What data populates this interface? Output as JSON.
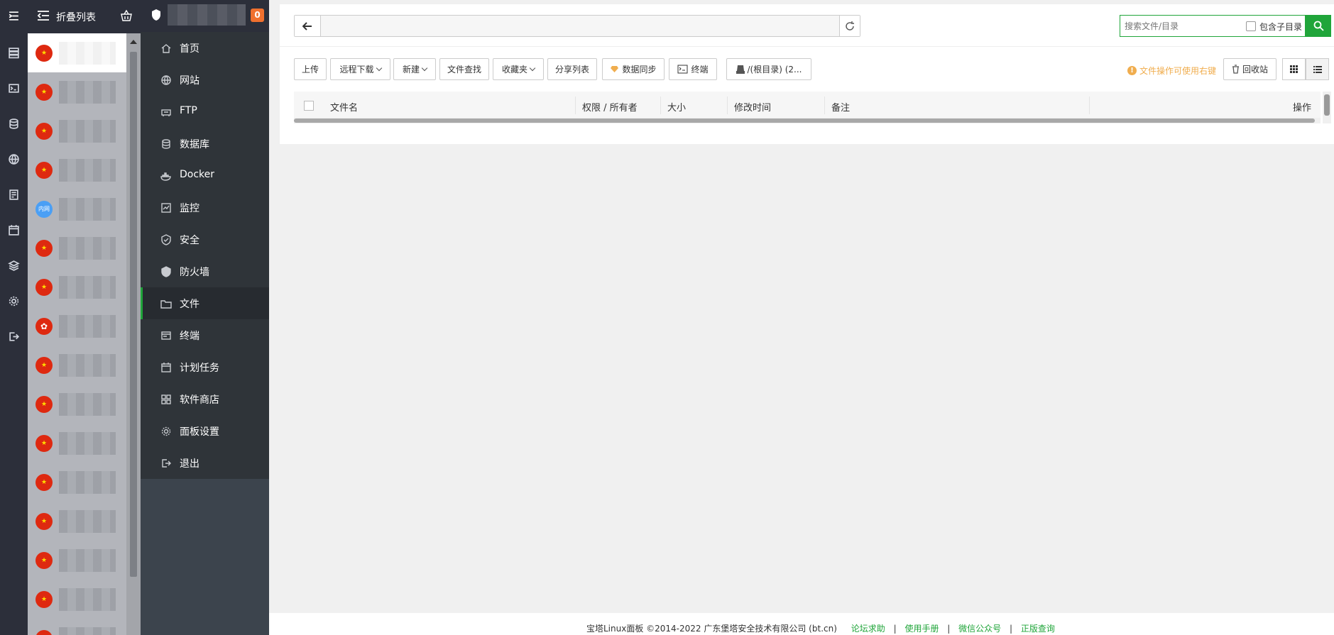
{
  "servers_panel": {
    "title": "折叠列表",
    "items": [
      {
        "flag": "cn",
        "selected": true
      },
      {
        "flag": "cn"
      },
      {
        "flag": "cn"
      },
      {
        "flag": "cn"
      },
      {
        "flag": "lan",
        "flag_text": "内网"
      },
      {
        "flag": "cn"
      },
      {
        "flag": "cn"
      },
      {
        "flag": "hk"
      },
      {
        "flag": "cn"
      },
      {
        "flag": "cn"
      },
      {
        "flag": "cn"
      },
      {
        "flag": "cn"
      },
      {
        "flag": "cn"
      },
      {
        "flag": "cn"
      },
      {
        "flag": "cn"
      },
      {
        "flag": "cn"
      }
    ]
  },
  "header": {
    "badge": "0"
  },
  "nav": {
    "items": [
      {
        "label": "首页",
        "icon": "home-icon"
      },
      {
        "label": "网站",
        "icon": "globe-icon"
      },
      {
        "label": "FTP",
        "icon": "ftp-icon"
      },
      {
        "label": "数据库",
        "icon": "database-icon"
      },
      {
        "label": "Docker",
        "icon": "docker-icon"
      },
      {
        "label": "监控",
        "icon": "monitor-icon"
      },
      {
        "label": "安全",
        "icon": "shield-icon"
      },
      {
        "label": "防火墙",
        "icon": "firewall-icon"
      },
      {
        "label": "文件",
        "icon": "folder-icon",
        "active": true
      },
      {
        "label": "终端",
        "icon": "terminal-icon"
      },
      {
        "label": "计划任务",
        "icon": "calendar-icon"
      },
      {
        "label": "软件商店",
        "icon": "apps-icon"
      },
      {
        "label": "面板设置",
        "icon": "gear-icon"
      },
      {
        "label": "退出",
        "icon": "logout-icon"
      }
    ]
  },
  "files": {
    "path_value": "",
    "search_placeholder": "搜索文件/目录",
    "include_subdir_label": "包含子目录",
    "toolbar": {
      "upload": "上传",
      "remote_download": "远程下载",
      "new": "新建",
      "file_search": "文件查找",
      "favorites": "收藏夹",
      "share_list": "分享列表",
      "data_sync": "数据同步",
      "terminal": "终端",
      "disk": "/(根目录) (2..."
    },
    "tip": "文件操作可使用右键",
    "recycle_bin": "回收站",
    "columns": {
      "name": "文件名",
      "perm_owner": "权限 / 所有者",
      "size": "大小",
      "mtime": "修改时间",
      "remark": "备注",
      "actions": "操作"
    }
  },
  "footer": {
    "copyright": "宝塔Linux面板 ©2014-2022 广东堡塔安全技术有限公司 (bt.cn)",
    "links": [
      "论坛求助",
      "使用手册",
      "微信公众号",
      "正版查询"
    ]
  },
  "colors": {
    "accent": "#20a53a",
    "badge": "#f0702e",
    "tip": "#f0ad4e",
    "sidebar": "#2f3439",
    "rail": "#2c2f3a"
  }
}
